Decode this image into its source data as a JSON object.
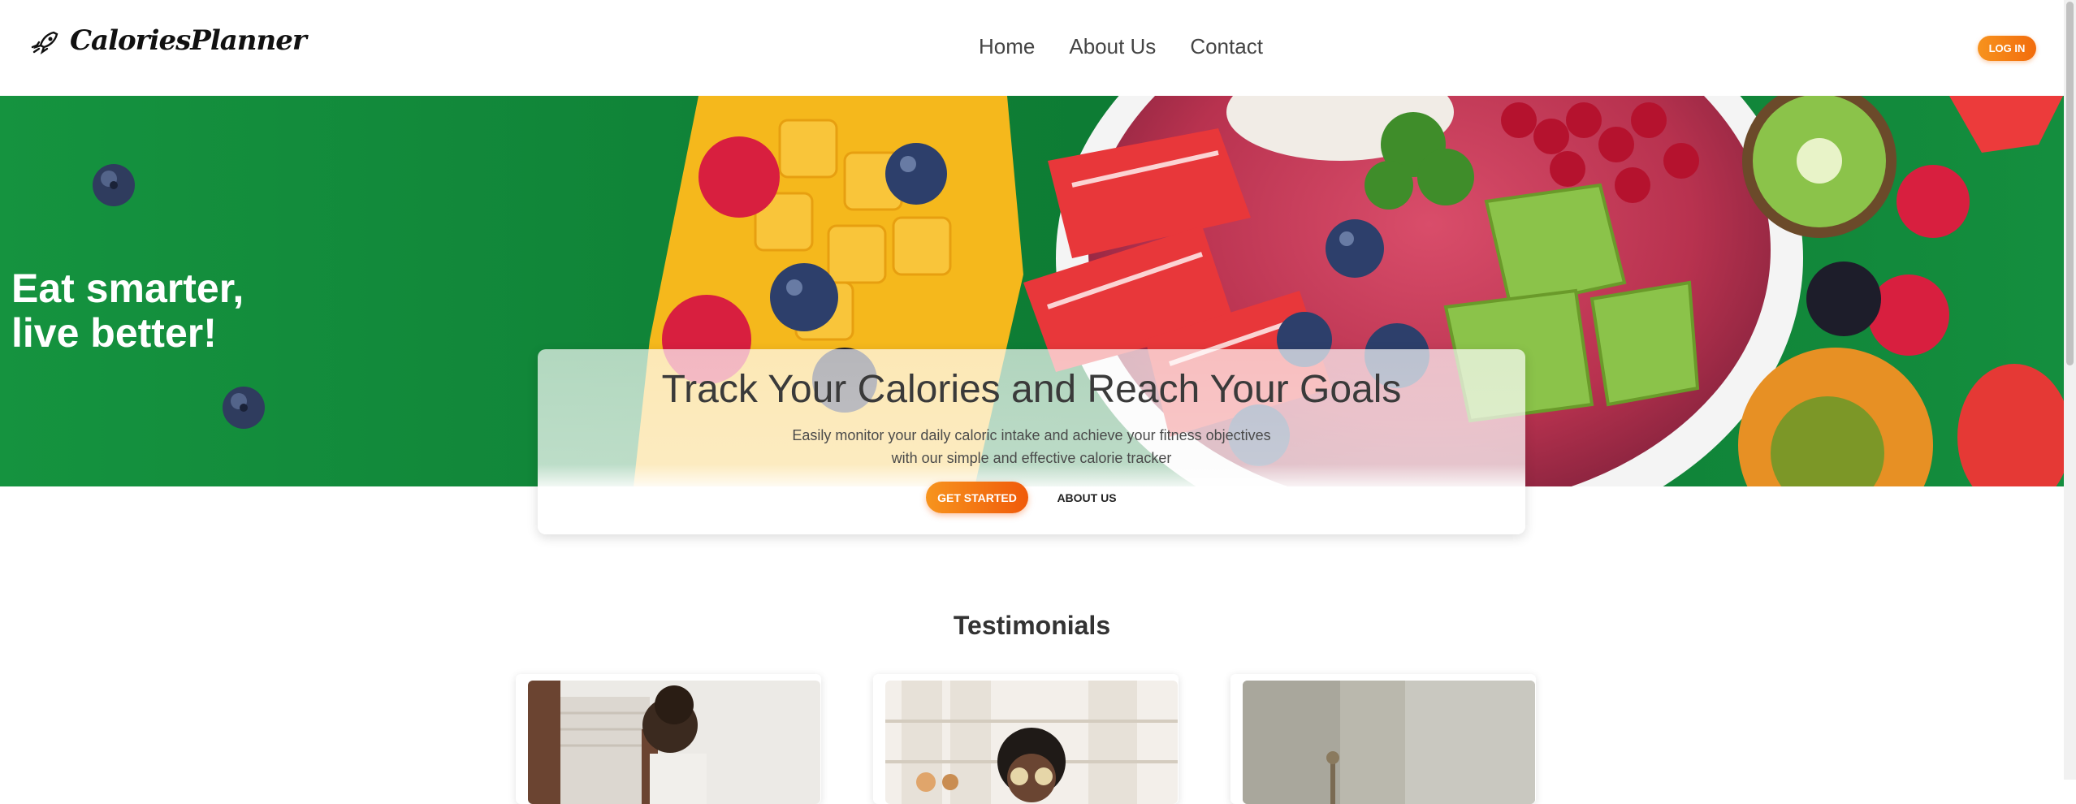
{
  "brand": {
    "name": "CaloriesPlanner"
  },
  "nav": {
    "links": [
      "Home",
      "About Us",
      "Contact"
    ],
    "login_label": "LOG IN"
  },
  "hero": {
    "headline_line1": "Eat smarter,",
    "headline_line2": "live better!"
  },
  "track": {
    "title": "Track Your Calories and Reach Your Goals",
    "subtitle_line1": "Easily monitor your daily caloric intake and achieve your fitness objectives",
    "subtitle_line2": "with our simple and effective calorie tracker",
    "get_started_label": "GET STARTED",
    "about_label": "ABOUT US"
  },
  "testimonials": {
    "title": "Testimonials"
  },
  "colors": {
    "accent": "#f7931e",
    "hero_green": "#138a3c"
  }
}
